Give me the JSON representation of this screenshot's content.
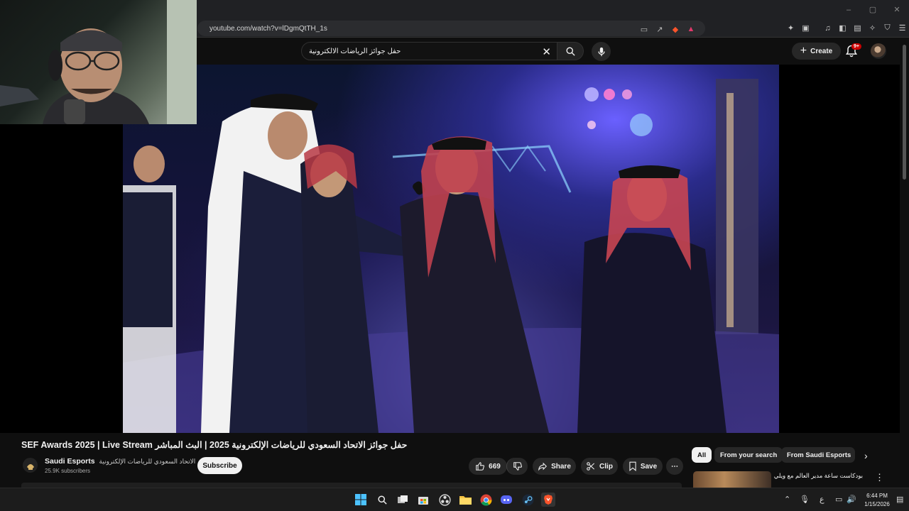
{
  "browser": {
    "url": "youtube.com/watch?v=lDgmQtTH_1s",
    "window_controls": [
      "–",
      "▢",
      "✕"
    ]
  },
  "header": {
    "search_query": "حفل جوائز الرياضات الالكترونية",
    "create_label": "Create",
    "notification_badge": "9+"
  },
  "video": {
    "title": "SEF Awards 2025 | Live Stream حفل جوائز الاتحاد السعودي للرياضات الإلكترونية 2025 | البث المباشر",
    "channel_name": "Saudi Esports",
    "channel_name_ar": "الاتحاد السعودي للرياضات الإلكترونية",
    "subscribers": "25.9K subscribers",
    "subscribe_label": "Subscribe",
    "likes": "669",
    "share_label": "Share",
    "clip_label": "Clip",
    "save_label": "Save",
    "more_label": "⋯"
  },
  "chips": {
    "all": "All",
    "from_search": "From your search",
    "from_channel": "From Saudi Esports"
  },
  "recommendation": {
    "title": "بودكاست ساعة مدير العالم مع ويلي | أم"
  },
  "taskbar": {
    "time": "6:44 PM",
    "date": "1/15/2026",
    "lang": "ع"
  },
  "colors": {
    "accent_red": "#cc0000",
    "background": "#0f0f0f",
    "chip_bg": "#272727"
  }
}
